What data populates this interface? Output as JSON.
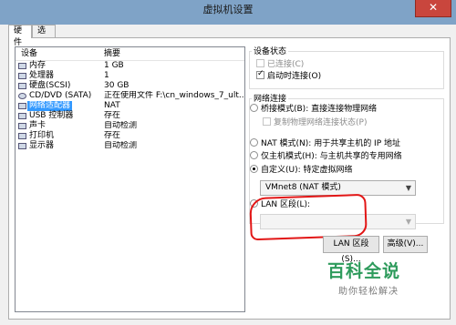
{
  "window": {
    "title": "虚拟机设置",
    "close_glyph": "✕"
  },
  "tabs": [
    {
      "label": "硬件"
    },
    {
      "label": "选项"
    }
  ],
  "devices": {
    "header_device": "设备",
    "header_summary": "摘要",
    "rows": [
      {
        "name": "内存",
        "summary": "1 GB",
        "icon": "memory-icon"
      },
      {
        "name": "处理器",
        "summary": "1",
        "icon": "cpu-icon"
      },
      {
        "name": "硬盘(SCSI)",
        "summary": "30 GB",
        "icon": "harddisk-icon"
      },
      {
        "name": "CD/DVD (SATA)",
        "summary": "正在使用文件 F:\\cn_windows_7_ult...",
        "icon": "cd-dvd-icon"
      },
      {
        "name": "网络适配器",
        "summary": "NAT",
        "icon": "network-adapter-icon"
      },
      {
        "name": "USB 控制器",
        "summary": "存在",
        "icon": "usb-icon"
      },
      {
        "name": "声卡",
        "summary": "自动检测",
        "icon": "sound-card-icon"
      },
      {
        "name": "打印机",
        "summary": "存在",
        "icon": "printer-icon"
      },
      {
        "name": "显示器",
        "summary": "自动检测",
        "icon": "display-icon"
      }
    ]
  },
  "device_status": {
    "title": "设备状态",
    "connected": {
      "label": "已连接(C)",
      "checked": false,
      "enabled": false
    },
    "connect_on_power": {
      "label": "启动时连接(O)",
      "checked": true,
      "enabled": true
    }
  },
  "network": {
    "title": "网络连接",
    "bridged": {
      "label": "桥接模式(B): 直接连接物理网络"
    },
    "replicate": {
      "label": "复制物理网络连接状态(P)"
    },
    "nat": {
      "label": "NAT 模式(N): 用于共享主机的 IP 地址"
    },
    "host_only": {
      "label": "仅主机模式(H): 与主机共享的专用网络"
    },
    "custom": {
      "label": "自定义(U): 特定虚拟网络",
      "selected": true
    },
    "custom_select": {
      "value": "VMnet8 (NAT 模式)"
    },
    "lan_segment": {
      "label": "LAN 区段(L):"
    },
    "lan_select": {
      "value": ""
    }
  },
  "buttons": {
    "lan_segments": "LAN 区段(S)...",
    "advanced": "高级(V)..."
  },
  "watermark": {
    "brand": "百科全说",
    "slogan": "助你轻松解决"
  },
  "colors": {
    "selection": "#3399ff",
    "annotation": "#e21616",
    "watermark": "#2e9b5c"
  }
}
